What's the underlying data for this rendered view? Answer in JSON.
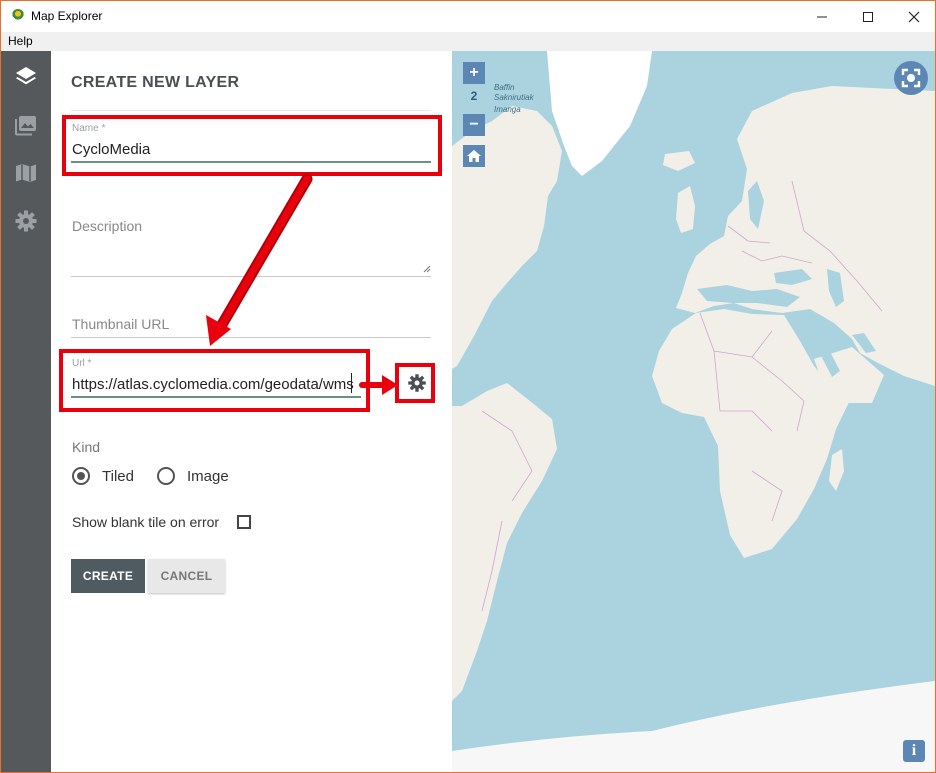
{
  "window": {
    "title": "Map Explorer",
    "minimize_icon": "minimize-icon",
    "maximize_icon": "maximize-icon",
    "close_icon": "close-icon"
  },
  "menu": {
    "items": [
      "Help"
    ]
  },
  "sidebar": {
    "icons": [
      "layers-icon",
      "image-icon",
      "map-icon",
      "gear-icon"
    ]
  },
  "form": {
    "title": "CREATE NEW LAYER",
    "name": {
      "label": "Name *",
      "value": "CycloMedia"
    },
    "description": {
      "placeholder": "Description",
      "value": ""
    },
    "thumbnail": {
      "placeholder": "Thumbnail URL",
      "value": ""
    },
    "url": {
      "label": "Url *",
      "value": "https://atlas.cyclomedia.com/geodata/wms",
      "settings_icon": "gear-icon"
    },
    "kind": {
      "label": "Kind",
      "options": [
        "Tiled",
        "Image"
      ],
      "selected": "Tiled"
    },
    "blank_tile": {
      "label": "Show blank tile on error",
      "checked": false
    },
    "buttons": {
      "create": "CREATE",
      "cancel": "CANCEL"
    }
  },
  "annotations": {
    "color": "#e8000c"
  },
  "map": {
    "zoom_in": "+",
    "zoom_level": "2",
    "zoom_out": "−",
    "home_icon": "home-icon",
    "screenshot_icon": "screenshot-icon",
    "info_label": "i",
    "place_labels": [
      "Baffin",
      "Saknirutiak",
      "Imanga"
    ],
    "colors": {
      "water": "#aad3df",
      "land": "#f2efe9",
      "ice": "#ffffff",
      "borders": "#cfa5cf",
      "controls": "#5c87b5"
    }
  }
}
